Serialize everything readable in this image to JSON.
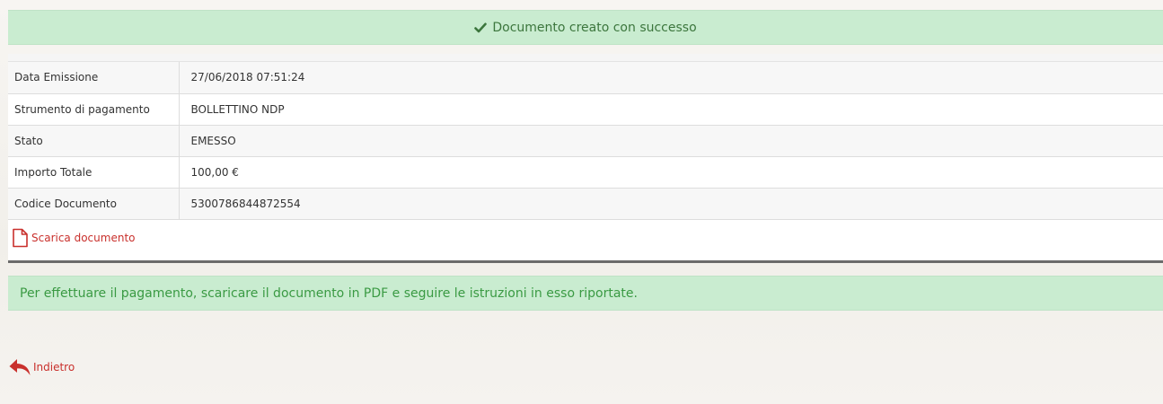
{
  "banner": {
    "message": "Documento creato con successo",
    "icon": "check-icon"
  },
  "details": [
    {
      "label": "Data Emissione",
      "value": "27/06/2018 07:51:24"
    },
    {
      "label": "Strumento di pagamento",
      "value": "BOLLETTINO NDP"
    },
    {
      "label": "Stato",
      "value": "EMESSO"
    },
    {
      "label": "Importo Totale",
      "value": "100,00 €"
    },
    {
      "label": "Codice Documento",
      "value": "5300786844872554"
    }
  ],
  "download": {
    "label": "Scarica documento",
    "icon": "file-icon"
  },
  "instructions": {
    "text": "Per effettuare il pagamento, scaricare il documento in PDF e seguire le istruzioni in esso riportate."
  },
  "back": {
    "label": "Indietro",
    "icon": "reply-arrow-icon"
  },
  "colors": {
    "success_bg": "#c9ecd0",
    "success_text": "#3c763d",
    "link_red": "#c9302c"
  }
}
